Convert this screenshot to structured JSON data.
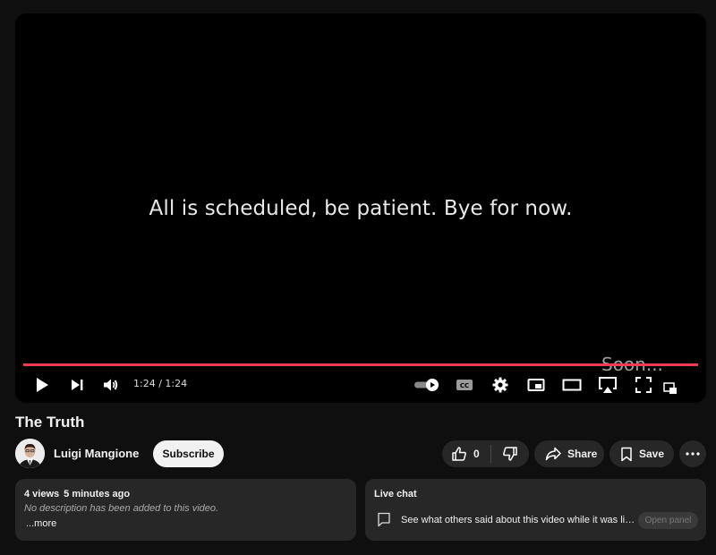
{
  "player": {
    "caption": "All is scheduled, be patient. Bye for now.",
    "overlay_text": "Soon...",
    "progress": 1.0,
    "progress_color": "#f03b52",
    "time_display": "1:24 / 1:24",
    "controls": {
      "play_icon": "play-icon",
      "next_icon": "skip-next-icon",
      "volume_icon": "volume-icon",
      "autoplay_icon": "autoplay-toggle-icon",
      "cc_label": "CC",
      "settings_icon": "gear-icon",
      "miniplayer_icon": "miniplayer-icon",
      "theater_icon": "theater-mode-icon",
      "airplay_icon": "airplay-icon",
      "fullscreen_icon": "fullscreen-icon",
      "cast_icon": "cast-icon"
    }
  },
  "video": {
    "title": "The Truth"
  },
  "channel": {
    "name": "Luigi Mangione",
    "subscribe_label": "Subscribe"
  },
  "actions": {
    "like_count": "0",
    "share_label": "Share",
    "save_label": "Save"
  },
  "description": {
    "views": "4 views",
    "age": "5 minutes ago",
    "text": "No description has been added to this video.",
    "more_label": "...more"
  },
  "live_chat": {
    "title": "Live chat",
    "text": "See what others said about this video while it was live.",
    "open_panel_label": "Open panel"
  },
  "colors": {
    "background": "#0f0f0f",
    "card": "#272727",
    "accent": "#f03b52"
  }
}
